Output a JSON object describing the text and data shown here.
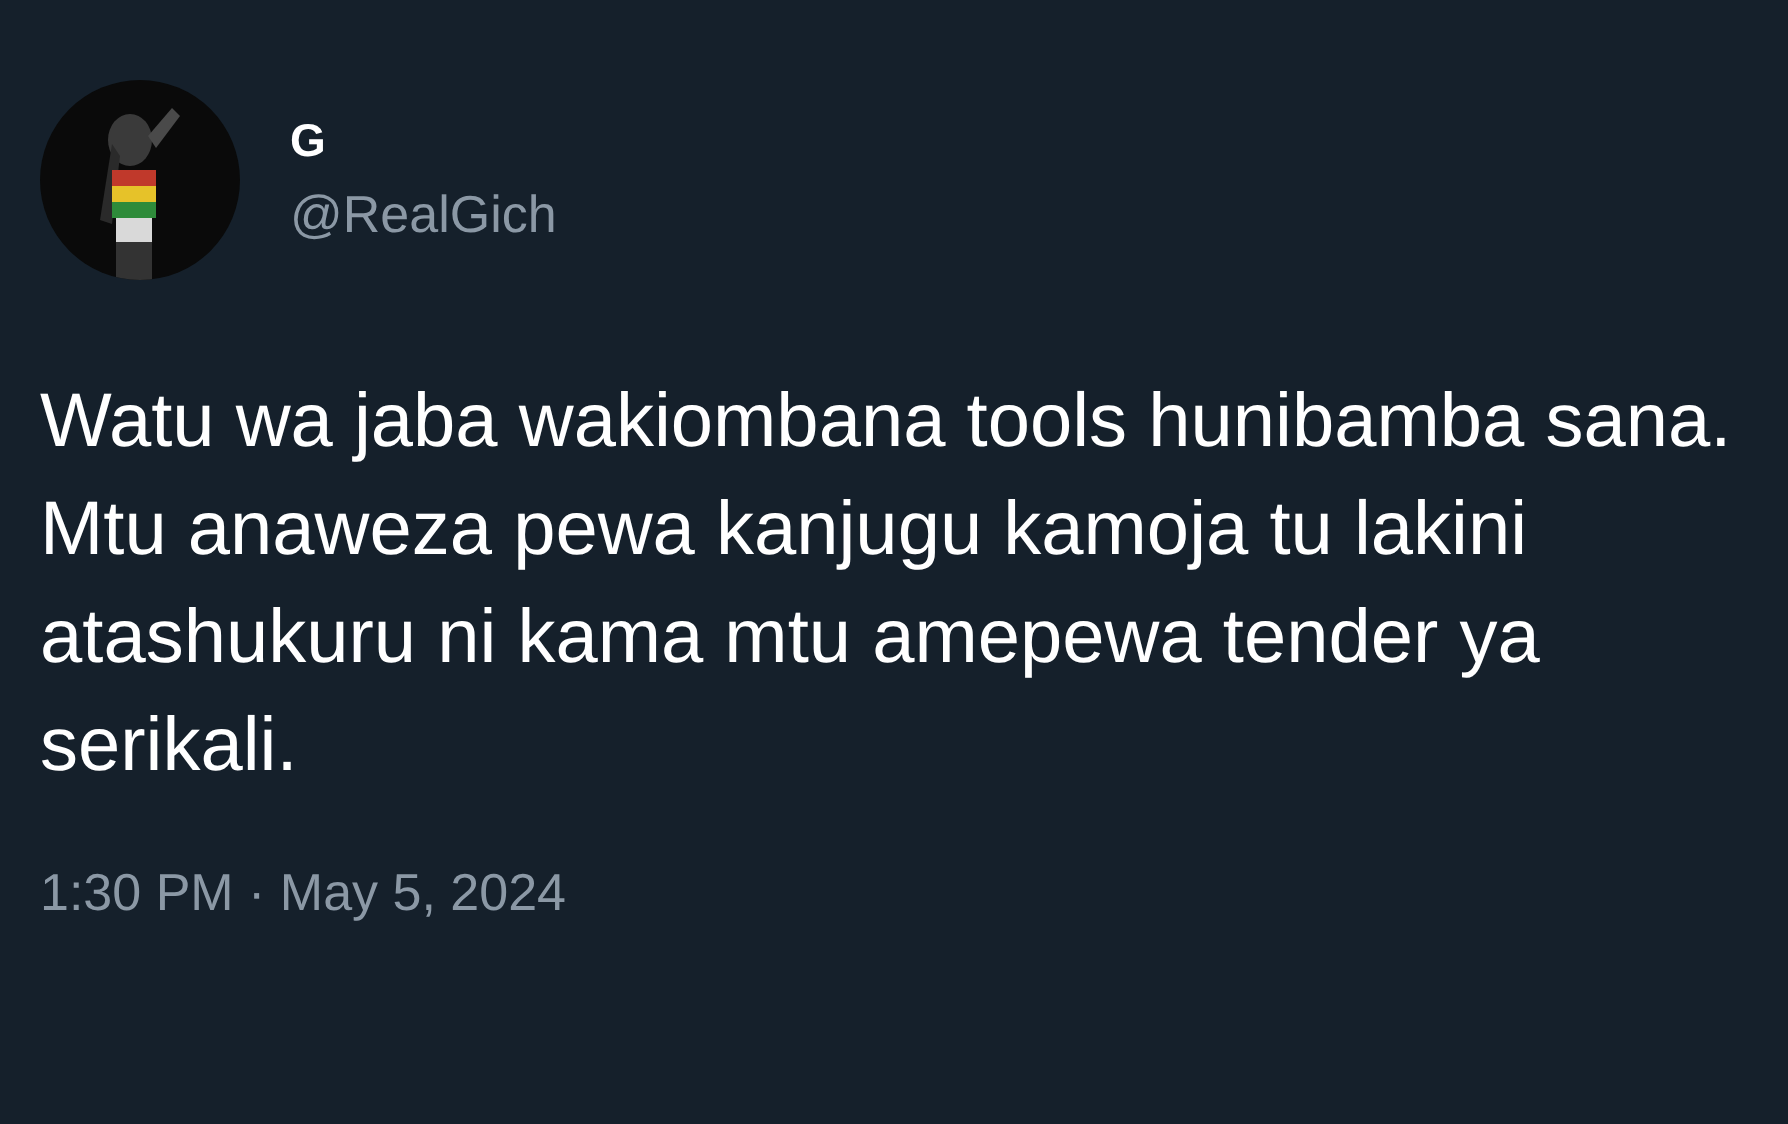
{
  "author": {
    "name": "G",
    "handle": "@RealGich"
  },
  "text": "Watu wa jaba wakiombana tools hunibamba sana. Mtu anaweza pewa kanjugu kamoja tu lakini atashukuru ni kama mtu amepewa tender ya serikali.",
  "timestamp": "1:30 PM · May 5, 2024"
}
